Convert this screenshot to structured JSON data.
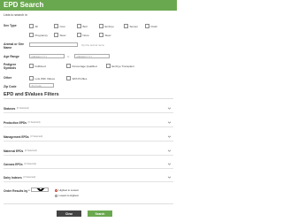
{
  "header": {
    "title": "EPD Search"
  },
  "lookup_label": "Lists to search in",
  "sex_type": {
    "label": "Sex Type",
    "row1": [
      "All",
      "Cow",
      "Bull",
      "Embryo",
      "Semen",
      "Flush"
    ],
    "row2": [
      "Pregnancy",
      "Steer",
      "None",
      "Steer"
    ]
  },
  "animal_or_sire": {
    "label": "Animal or Sire Name",
    "note": "Opt the animal name"
  },
  "age_range": {
    "label": "Age Range",
    "from_placeholder": "MM/DD/YYYY",
    "to": "to",
    "to_placeholder": "MM/DD/YYYY"
  },
  "pedigree": {
    "label": "Pedigree Symbols",
    "options": [
      "Fullblood",
      "Percentage Qualified",
      "Embryo Transplant"
    ]
  },
  "other": {
    "label": "Other",
    "options": [
      "Lots With Videos",
      "With Profiles"
    ]
  },
  "zip": {
    "label": "Zip Code",
    "placeholder": "Zip Code"
  },
  "filters_title": "EPD and $Values Filters",
  "filters": [
    {
      "name": "Statuses",
      "selected": "(0 Selected)"
    },
    {
      "name": "Production EPDs",
      "selected": "(0 Selected)"
    },
    {
      "name": "Management EPDs",
      "selected": "(0 Selected)"
    },
    {
      "name": "Maternal EPDs",
      "selected": "(0 Selected)"
    },
    {
      "name": "Carcass EPDs",
      "selected": "(0 Selected)"
    },
    {
      "name": "Dairy Indexes",
      "selected": "(0 Selected)"
    }
  ],
  "order": {
    "label": "Order Results by *",
    "value": "All",
    "radios": [
      "Highest to Lowest",
      "Lowest to Highest"
    ],
    "selected_index": 0
  },
  "buttons": {
    "clear": "Clear",
    "search": "Search"
  },
  "colors": {
    "brand": "#6aa84f",
    "dark": "#444444"
  }
}
